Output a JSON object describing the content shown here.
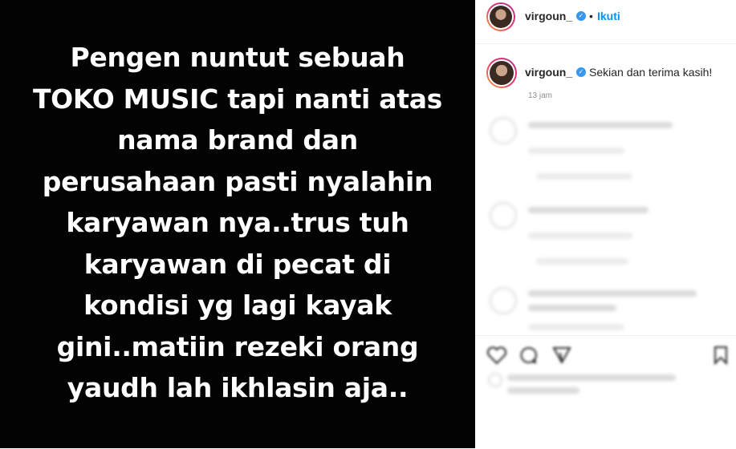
{
  "post": {
    "lines": [
      "Pengen nuntut sebuah",
      "TOKO MUSIC tapi nanti atas",
      "nama brand dan",
      "perusahaan pasti nyalahin",
      "karyawan nya..trus tuh",
      "karyawan di pecat di",
      "kondisi yg lagi kayak",
      "gini..matiin rezeki orang",
      "yaudh lah ikhlasin aja.."
    ]
  },
  "header": {
    "username": "virgoun_",
    "separator": "•",
    "follow_label": "Ikuti"
  },
  "caption": {
    "username": "virgoun_",
    "text": "Sekian dan terima kasih!",
    "time": "13 jam"
  },
  "icons": {
    "verified": "verified-badge-icon",
    "like": "heart-icon",
    "comment": "comment-icon",
    "share": "share-icon",
    "save": "bookmark-icon"
  },
  "colors": {
    "accent": "#0095f6",
    "verified": "#3897f0",
    "post_background": "#030303"
  }
}
